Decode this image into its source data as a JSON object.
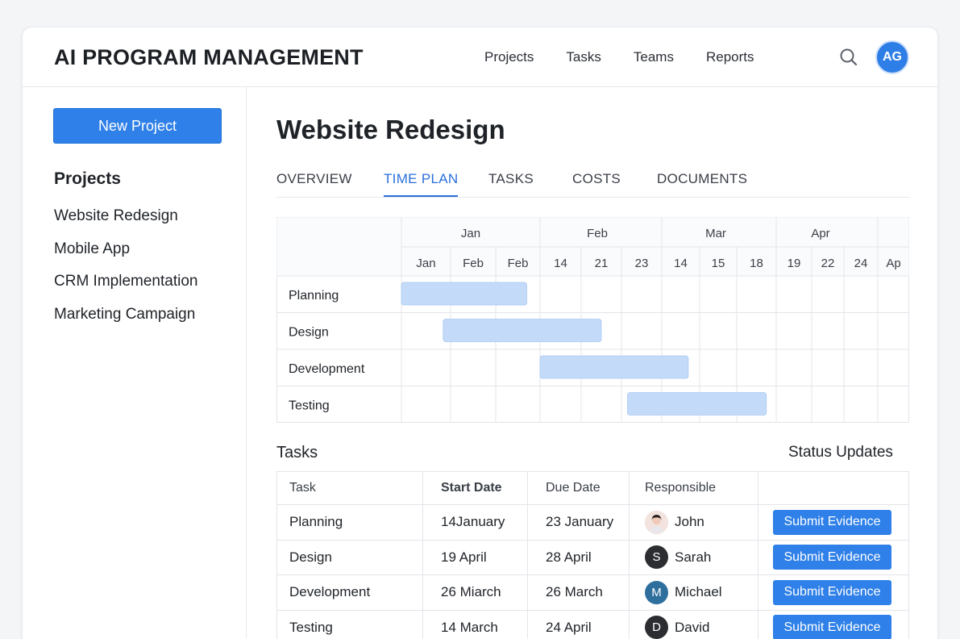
{
  "app": {
    "title": "AI PROGRAM MANAGEMENT",
    "user_initials": "AG"
  },
  "nav": [
    {
      "label": "Projects"
    },
    {
      "label": "Tasks"
    },
    {
      "label": "Teams"
    },
    {
      "label": "Reports"
    }
  ],
  "icons": {
    "search": "search-icon"
  },
  "sidebar": {
    "new_project_label": "New Project",
    "heading": "Projects",
    "items": [
      {
        "label": "Website Redesign"
      },
      {
        "label": "Mobile App"
      },
      {
        "label": "CRM Implementation"
      },
      {
        "label": "Marketing Campaign"
      }
    ]
  },
  "main": {
    "title": "Website Redesign",
    "tabs": [
      {
        "label": "OVERVIEW",
        "active": false
      },
      {
        "label": "TIME PLAN",
        "active": true
      },
      {
        "label": "TASKS",
        "active": false
      },
      {
        "label": "COSTS",
        "active": false
      },
      {
        "label": "DOCUMENTS",
        "active": false
      }
    ]
  },
  "gantt": {
    "months": [
      "Jan",
      "Feb",
      "Mar",
      "Apr"
    ],
    "columns": [
      "Jan",
      "Feb",
      "Feb",
      "14",
      "21",
      "23",
      "14",
      "15",
      "18",
      "19",
      "22",
      "24",
      "Ap"
    ],
    "rows": [
      {
        "label": "Planning",
        "start": 0,
        "end": 2.7
      },
      {
        "label": "Design",
        "start": 0.85,
        "end": 4.5
      },
      {
        "label": "Development",
        "start": 3,
        "end": 6.7
      },
      {
        "label": "Testing",
        "start": 5.15,
        "end": 8.75
      }
    ],
    "bar_color": "#c3dbf8",
    "bar_border": "#a9c9f2"
  },
  "tasks_section": {
    "heading": "Tasks",
    "status_heading": "Status Updates",
    "columns": [
      "Task",
      "Start Date",
      "Due Date",
      "Responsible",
      ""
    ],
    "rows": [
      {
        "task": "Planning",
        "start": "14January",
        "due": "23 January",
        "person": "John",
        "initial": "",
        "avatar_color": "#f1d8d2",
        "action": "Submit Evidence"
      },
      {
        "task": "Design",
        "start": "19 April",
        "due": "28 April",
        "person": "Sarah",
        "initial": "S",
        "avatar_color": "#2b2d31",
        "action": "Submit Evidence"
      },
      {
        "task": "Development",
        "start": "26 Miarch",
        "due": "26 March",
        "person": "Michael",
        "initial": "M",
        "avatar_color": "#2e6f9e",
        "action": "Submit Evidence"
      },
      {
        "task": "Testing",
        "start": "14 March",
        "due": "24 April",
        "person": "David",
        "initial": "D",
        "avatar_color": "#2b2d31",
        "action": "Submit Evidence"
      }
    ]
  },
  "colors": {
    "accent": "#2f80e8",
    "active_tab": "#2a6fdb"
  }
}
